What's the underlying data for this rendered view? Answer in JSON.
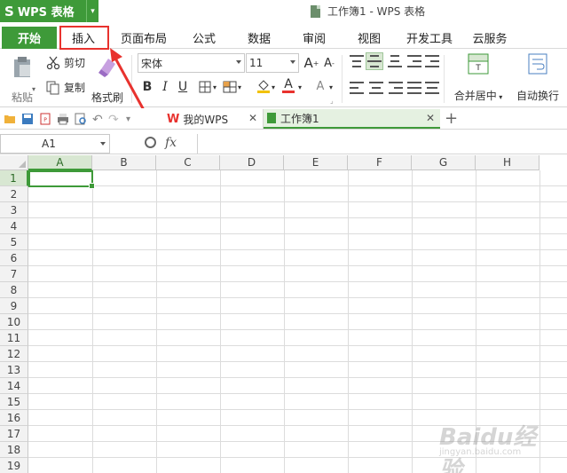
{
  "app": {
    "name": "WPS 表格",
    "window_title": "工作簿1 - WPS 表格",
    "brand_color": "#3e9a39"
  },
  "menu": {
    "tabs": [
      {
        "label": "开始",
        "active": true
      },
      {
        "label": "插入",
        "active": false
      },
      {
        "label": "页面布局",
        "active": false
      },
      {
        "label": "公式",
        "active": false
      },
      {
        "label": "数据",
        "active": false
      },
      {
        "label": "审阅",
        "active": false
      },
      {
        "label": "视图",
        "active": false
      },
      {
        "label": "开发工具",
        "active": false
      },
      {
        "label": "云服务",
        "active": false
      }
    ]
  },
  "ribbon": {
    "paste_label": "粘贴",
    "cut_label": "剪切",
    "copy_label": "复制",
    "format_painter_label": "格式刷",
    "font_name": "宋体",
    "font_size": "11",
    "merge_center_label": "合并居中",
    "wrap_text_label": "自动换行",
    "bold": "B",
    "italic": "I",
    "underline": "U",
    "font_color_letter": "A"
  },
  "doc_tabs": [
    {
      "label": "我的WPS"
    },
    {
      "label": "工作簿1"
    }
  ],
  "formula_bar": {
    "cell_ref": "A1",
    "fx": "fx",
    "formula": ""
  },
  "sheet": {
    "columns": [
      "A",
      "B",
      "C",
      "D",
      "E",
      "F",
      "G",
      "H"
    ],
    "rows": [
      "1",
      "2",
      "3",
      "4",
      "5",
      "6",
      "7",
      "8",
      "9",
      "10",
      "11",
      "12",
      "13",
      "14",
      "15",
      "16",
      "17",
      "18",
      "19"
    ],
    "selected_cell": "A1"
  },
  "watermark": {
    "main": "Baidu经验",
    "sub": "jingyan.baidu.com"
  }
}
